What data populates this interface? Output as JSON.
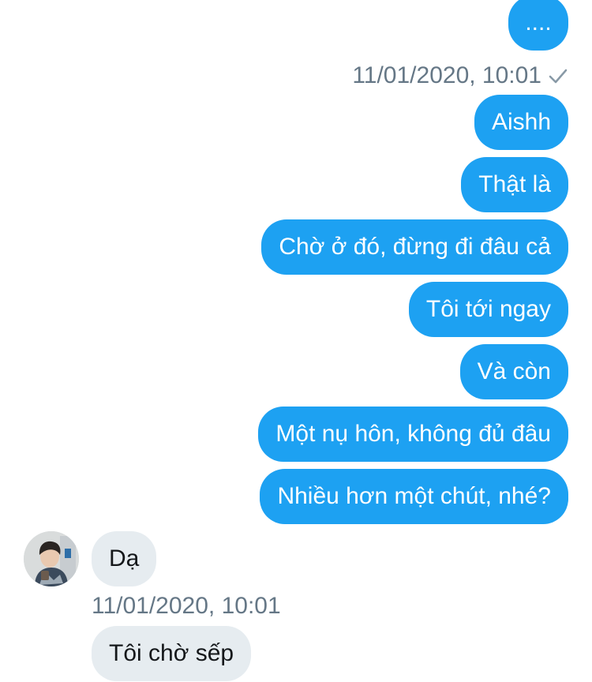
{
  "colors": {
    "outgoing_bubble": "#1da1f2",
    "incoming_bubble": "#e6ecf0",
    "timestamp": "#657786"
  },
  "conversation": {
    "top_message": "....",
    "outgoing_timestamp": "11/01/2020, 10:01",
    "read_receipt_icon": "checkmark-icon",
    "outgoing_messages": [
      "Aishh",
      "Thật là",
      "Chờ ở đó, đừng đi đâu cả",
      "Tôi tới ngay",
      "Và còn",
      "Một nụ hôn, không đủ đâu",
      "Nhiều hơn một chút, nhé?"
    ],
    "incoming_messages": [
      "Dạ",
      "Tôi chờ sếp"
    ],
    "incoming_timestamp": "11/01/2020, 10:01",
    "contact_avatar_icon": "contact-avatar"
  }
}
